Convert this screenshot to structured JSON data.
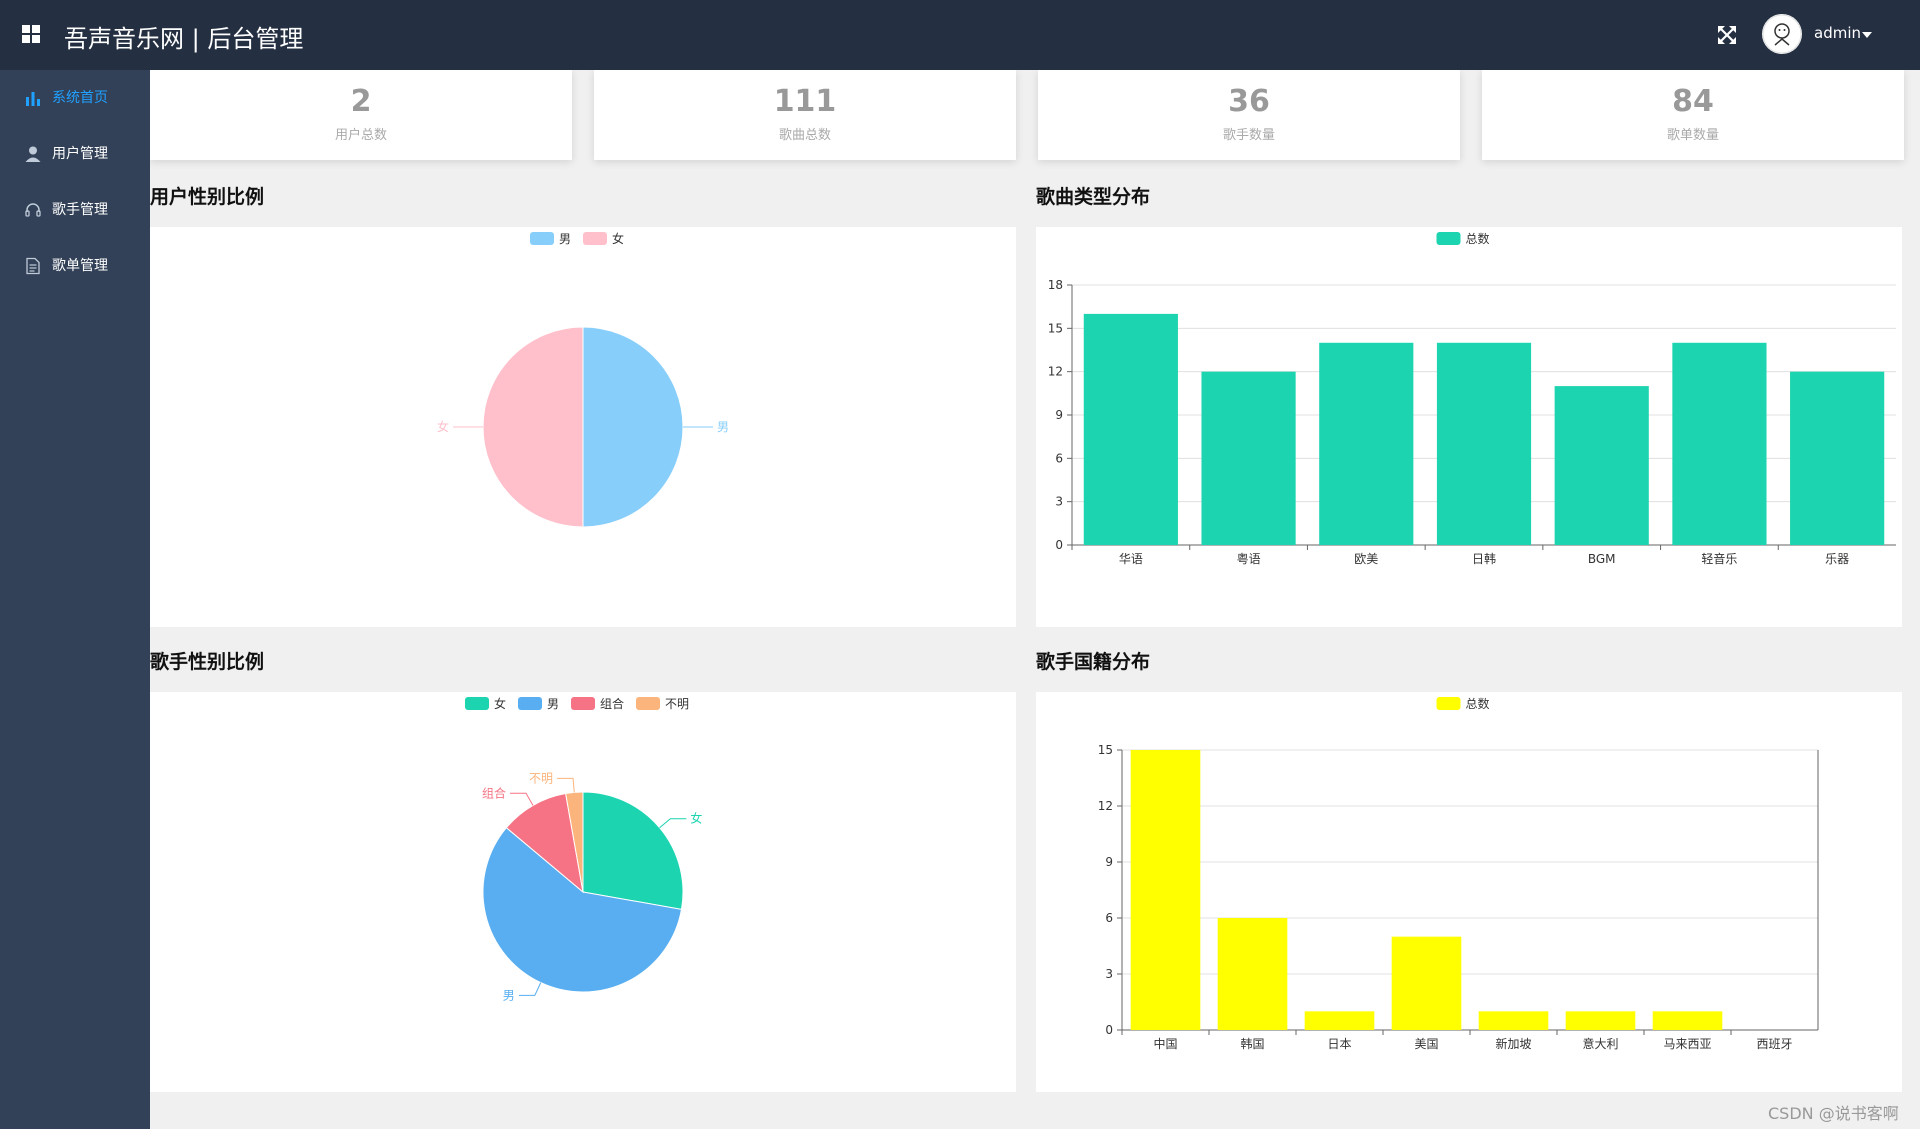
{
  "header": {
    "title": "吾声音乐网 | 后台管理",
    "user_name": "admin",
    "icons": [
      "grid-menu-icon",
      "fullscreen-icon",
      "avatar",
      "caret-down-icon"
    ]
  },
  "sidebar": {
    "items": [
      {
        "label": "系统首页",
        "icon": "bar-chart-icon",
        "active": true
      },
      {
        "label": "用户管理",
        "icon": "user-icon",
        "active": false
      },
      {
        "label": "歌手管理",
        "icon": "headset-icon",
        "active": false
      },
      {
        "label": "歌单管理",
        "icon": "document-icon",
        "active": false
      }
    ]
  },
  "stats": [
    {
      "value": "2",
      "label": "用户总数"
    },
    {
      "value": "111",
      "label": "歌曲总数"
    },
    {
      "value": "36",
      "label": "歌手数量"
    },
    {
      "value": "84",
      "label": "歌单数量"
    }
  ],
  "sections": {
    "user_gender": "用户性别比例",
    "song_type": "歌曲类型分布",
    "singer_gender": "歌手性别比例",
    "singer_nation": "歌手国籍分布"
  },
  "colors": {
    "topbar": "#242f42",
    "sidebar": "#324157",
    "active": "#20a0ff",
    "male": "#87cefa",
    "female": "#ffc0cb",
    "teal": "#1cd4b0",
    "blue": "#58aef0",
    "red": "#f57384",
    "orange": "#fbb47c",
    "yellow": "#ffff00"
  },
  "chart_data": [
    {
      "type": "pie",
      "legend": [
        "男",
        "女"
      ],
      "labels": [
        "男",
        "女"
      ],
      "values": [
        1,
        1
      ],
      "colors": [
        "#87cefa",
        "#ffc0cb"
      ]
    },
    {
      "type": "bar",
      "legend": [
        "总数"
      ],
      "series": [
        {
          "name": "总数",
          "values": [
            16,
            12,
            14,
            14,
            11,
            14,
            12
          ]
        }
      ],
      "categories": [
        "华语",
        "粤语",
        "欧美",
        "日韩",
        "BGM",
        "轻音乐",
        "乐器"
      ],
      "yticks": [
        "0",
        "3",
        "6",
        "9",
        "12",
        "15",
        "18"
      ],
      "ylim": [
        0,
        18
      ],
      "color": "#1cd4b0",
      "grid": true
    },
    {
      "type": "pie",
      "legend": [
        "女",
        "男",
        "组合",
        "不明"
      ],
      "labels": [
        "女",
        "男",
        "组合",
        "不明"
      ],
      "values": [
        10,
        21,
        4,
        1
      ],
      "colors": [
        "#1cd4b0",
        "#58aef0",
        "#f57384",
        "#fbb47c"
      ]
    },
    {
      "type": "bar",
      "legend": [
        "总数"
      ],
      "series": [
        {
          "name": "总数",
          "values": [
            15,
            6,
            1,
            5,
            1,
            1,
            1,
            0
          ]
        }
      ],
      "categories": [
        "中国",
        "韩国",
        "日本",
        "美国",
        "新加坡",
        "意大利",
        "马来西亚",
        "西班牙"
      ],
      "yticks": [
        "0",
        "3",
        "6",
        "9",
        "12",
        "15"
      ],
      "ylim": [
        0,
        15
      ],
      "color": "#ffff00",
      "grid": true
    }
  ],
  "watermark": "CSDN @说书客啊"
}
